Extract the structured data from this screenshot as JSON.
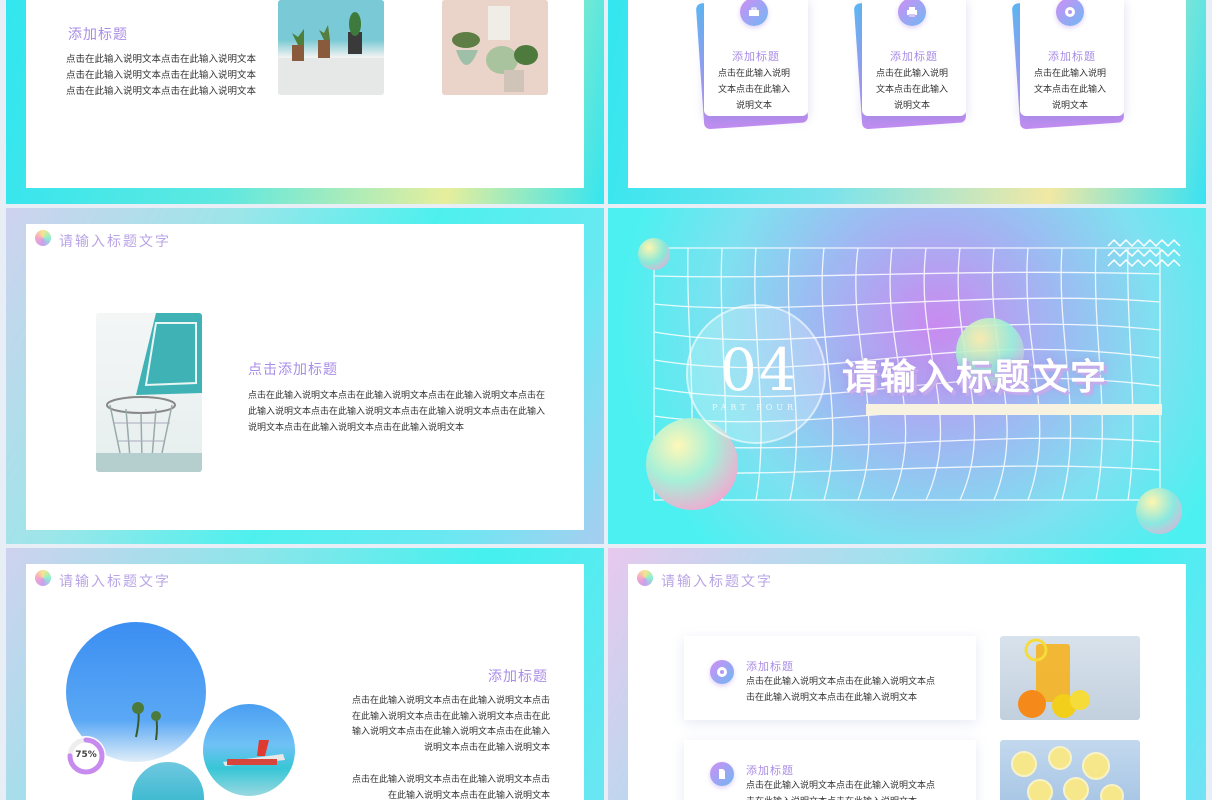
{
  "slide1": {
    "subtitle": "添加标题",
    "body": "点击在此输入说明文本点击在此输入说明文本点击在此输入说明文本点击在此输入说明文本点击在此输入说明文本点击在此输入说明文本"
  },
  "slide2": {
    "cards": [
      {
        "icon": "briefcase-icon",
        "title": "添加标题",
        "body": "点击在此输入说明文本点击在此输入说明文本"
      },
      {
        "icon": "printer-icon",
        "title": "添加标题",
        "body": "点击在此输入说明文本点击在此输入说明文本"
      },
      {
        "icon": "disc-icon",
        "title": "添加标题",
        "body": "点击在此输入说明文本点击在此输入说明文本"
      }
    ]
  },
  "slide3": {
    "header": "请输入标题文字",
    "subtitle": "点击添加标题",
    "body": "点击在此输入说明文本点击在此输入说明文本点击在此输入说明文本点击在此输入说明文本点击在此输入说明文本点击在此输入说明文本点击在此输入说明文本点击在此输入说明文本点击在此输入说明文本"
  },
  "slide4": {
    "number": "04",
    "part": "PART FOUR",
    "title": "请输入标题文字"
  },
  "slide5": {
    "header": "请输入标题文字",
    "subtitle": "添加标题",
    "percent": "75%",
    "percent_value": 75,
    "body1": "点击在此输入说明文本点击在此输入说明文本点击在此输入说明文本点击在此输入说明文本点击在此输入说明文本点击在此输入说明文本点击在此输入说明文本点击在此输入说明文本",
    "body2": "点击在此输入说明文本点击在此输入说明文本点击在此输入说明文本点击在此输入说明文本"
  },
  "slide6": {
    "header": "请输入标题文字",
    "items": [
      {
        "icon": "disc-icon",
        "title": "添加标题",
        "body": "点击在此输入说明文本点击在此输入说明文本点击在此输入说明文本点击在此输入说明文本"
      },
      {
        "icon": "document-icon",
        "title": "添加标题",
        "body": "点击在此输入说明文本点击在此输入说明文本点击在此输入说明文本点击在此输入说明文本"
      }
    ]
  }
}
